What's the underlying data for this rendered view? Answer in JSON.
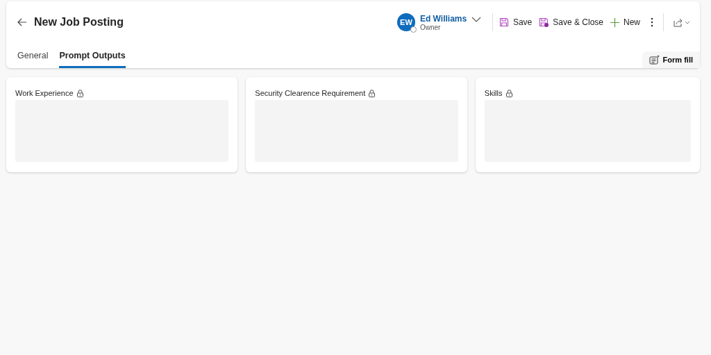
{
  "header": {
    "title": "New Job Posting",
    "tabs": [
      {
        "label": "General",
        "selected": false
      },
      {
        "label": "Prompt Outputs",
        "selected": true
      }
    ],
    "owner": {
      "initials": "EW",
      "name": "Ed Williams",
      "role": "Owner"
    },
    "commands": [
      {
        "kind": "save",
        "label": "Save"
      },
      {
        "kind": "save-close",
        "label": "Save & Close"
      },
      {
        "kind": "new",
        "label": "New"
      }
    ],
    "form_fill": "Form fill"
  },
  "fields": [
    {
      "label": "Work Experience",
      "locked": true
    },
    {
      "label": "Security Clearence Requirement",
      "locked": true
    },
    {
      "label": "Skills",
      "locked": true
    }
  ]
}
